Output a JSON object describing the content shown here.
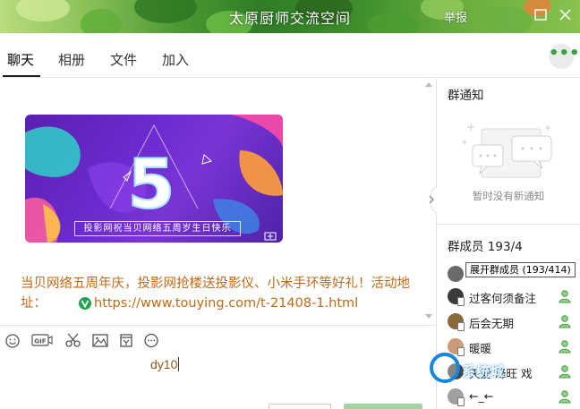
{
  "window": {
    "title": "太原厨师交流空间",
    "report_label": "举报",
    "colors": {
      "titlebar_green": "#2f7d26",
      "accent_green": "#39a34a",
      "message_orange": "#c06a16"
    }
  },
  "tabs": [
    {
      "label": "聊天",
      "active": true
    },
    {
      "label": "相册",
      "active": false
    },
    {
      "label": "文件",
      "active": false
    },
    {
      "label": "加入",
      "active": false
    }
  ],
  "more_button": {
    "icon": "more-dots-icon",
    "label": "•••"
  },
  "chat": {
    "banner": {
      "big_numeral": "5",
      "caption": "投影网祝当贝网络五周岁生日快乐"
    },
    "message": {
      "text": "当贝网络五周年庆，投影网抢楼送投影仪、小米手环等好礼！活动地址：",
      "link": "https://www.touying.com/t-21408-1.html"
    }
  },
  "toolbar": {
    "tools": [
      {
        "name": "emoji-icon",
        "label": "emoji"
      },
      {
        "name": "gif-icon",
        "label": "GIF"
      },
      {
        "name": "scissors-icon",
        "label": "screenshot"
      },
      {
        "name": "image-icon",
        "label": "image"
      },
      {
        "name": "bag-icon",
        "label": "gift"
      },
      {
        "name": "more-circle-icon",
        "label": "more"
      }
    ]
  },
  "input": {
    "value": "dy10"
  },
  "notice": {
    "title": "群通知",
    "empty_text": "暂时没有新通知"
  },
  "members": {
    "title": "群成员",
    "count_shown": "193/4",
    "tooltip": "展开群成员 (193/414)",
    "list": [
      {
        "name": "",
        "avatar_color": "#6b6b6b"
      },
      {
        "name": "过客何须备注",
        "avatar_color": "#3a3a3a"
      },
      {
        "name": "后会无期",
        "avatar_color": "#8a6a3a"
      },
      {
        "name": "暖暖",
        "avatar_color": "#c99a7a"
      },
      {
        "name": "天爱 峰旺 戏",
        "avatar_color": "#444444"
      },
      {
        "name": "←_←",
        "avatar_color": "#a0a0a0"
      }
    ]
  },
  "watermark": {
    "text": "系统城"
  }
}
